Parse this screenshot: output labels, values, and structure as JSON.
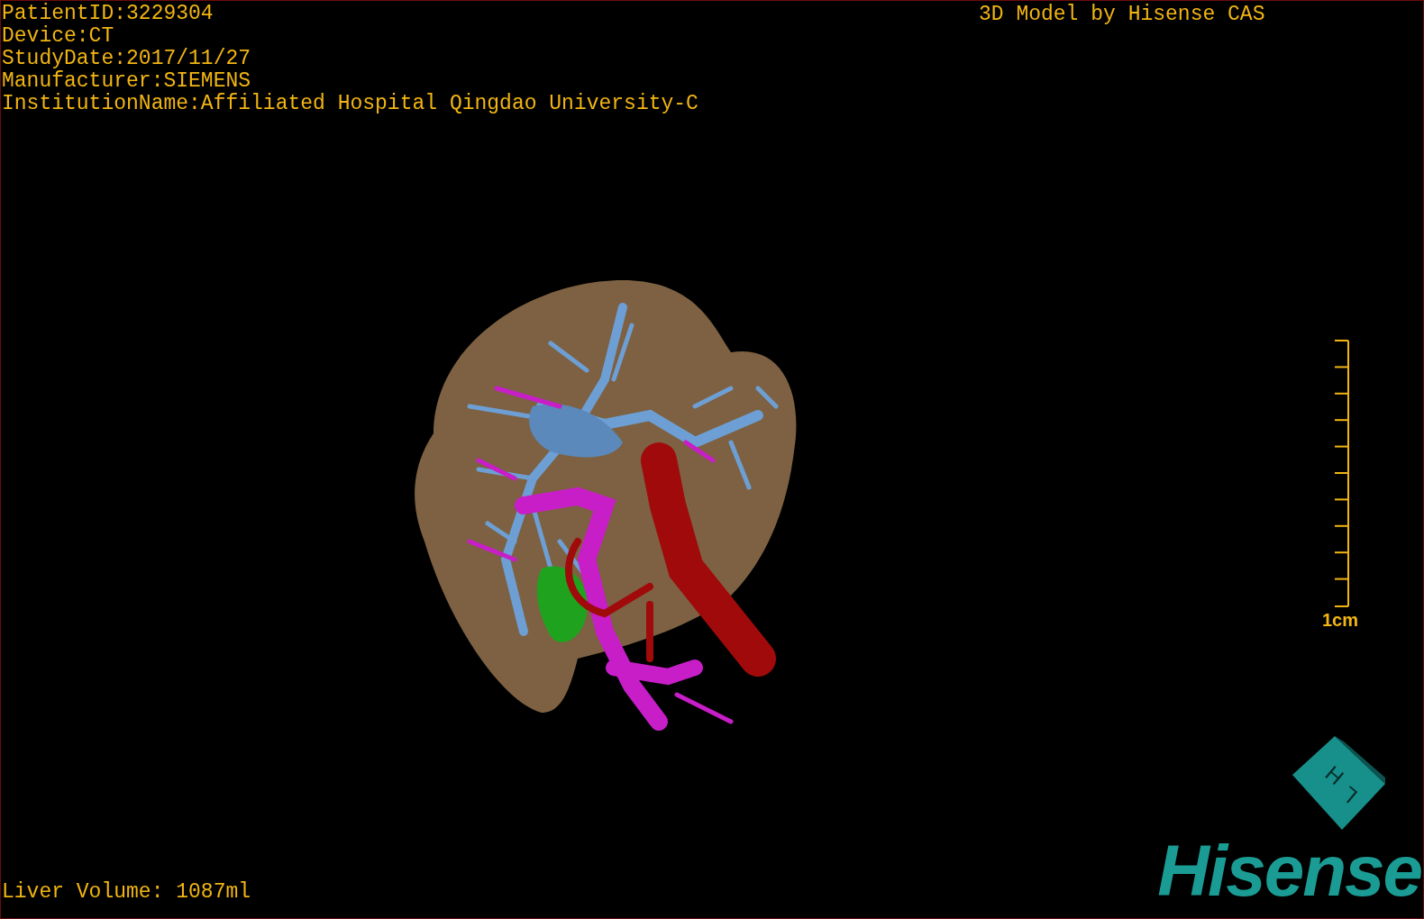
{
  "study_info": [
    "PatientID:3229304",
    "Device:CT",
    "StudyDate:2017/11/27",
    "Manufacturer:SIEMENS",
    "InstitutionName:Affiliated Hospital Qingdao University-C"
  ],
  "title": "3D Model by Hisense CAS",
  "scale": {
    "label": "1cm"
  },
  "liver_volume": "Liver Volume: 1087ml",
  "orientation_cube": {
    "labels": [
      "H",
      "L"
    ]
  },
  "logo": "Hisense"
}
